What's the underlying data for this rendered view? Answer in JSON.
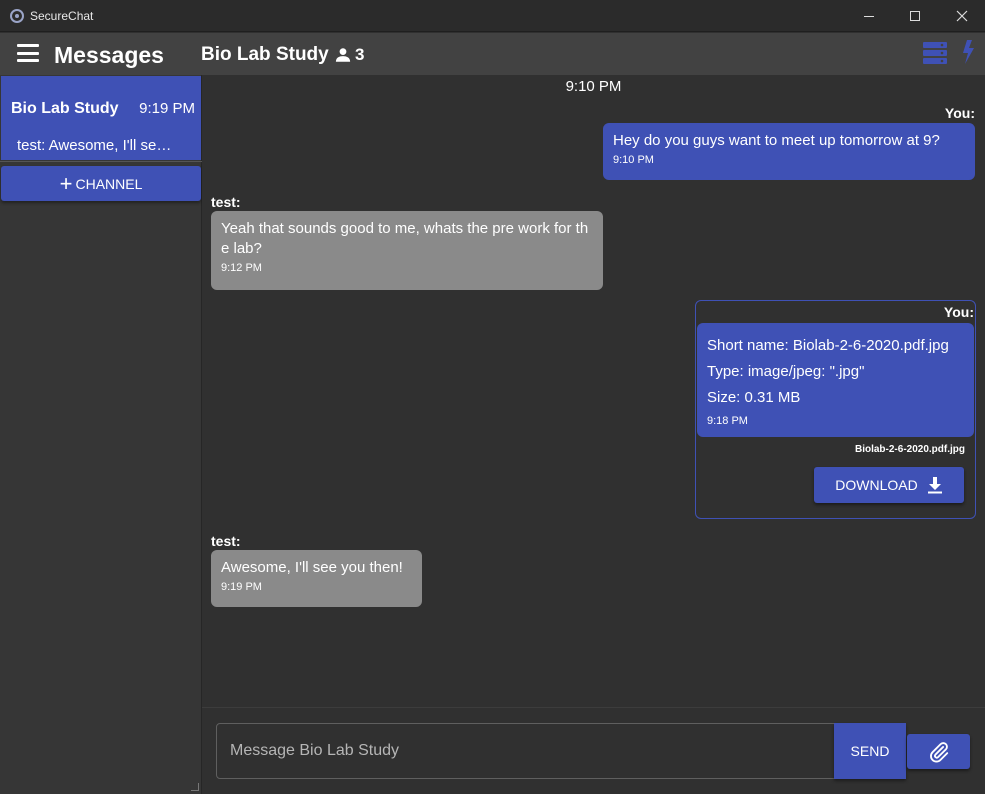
{
  "window": {
    "title": "SecureChat"
  },
  "header": {
    "title": "Messages",
    "channel_name": "Bio Lab Study",
    "member_count": "3"
  },
  "sidebar": {
    "channels": [
      {
        "name": "Bio Lab Study",
        "time": "9:19 PM",
        "preview": "test: Awesome, I'll see you then!"
      }
    ],
    "add_channel_label": "CHANNEL"
  },
  "chat": {
    "date_separator": "9:10 PM",
    "messages": [
      {
        "sender": "You:",
        "text": "Hey do you guys want to meet up tomorrow at 9?",
        "time": "9:10 PM"
      },
      {
        "sender": "test:",
        "text": "Yeah that sounds good to me, whats the pre work for the lab?",
        "time": "9:12 PM"
      },
      {
        "sender": "You:",
        "file": {
          "short_name": "Short name: Biolab-2-6-2020.pdf.jpg",
          "type": "Type: image/jpeg: \".jpg\"",
          "size": "Size: 0.31 MB",
          "filename": "Biolab-2-6-2020.pdf.jpg",
          "download_label": "DOWNLOAD"
        },
        "time": "9:18 PM"
      },
      {
        "sender": "test:",
        "text": "Awesome, I'll see you then!",
        "time": "9:19 PM"
      }
    ]
  },
  "composer": {
    "placeholder": "Message Bio Lab Study",
    "send_label": "SEND"
  },
  "colors": {
    "accent": "#3f51b5",
    "other_bubble": "#8a8a8a",
    "background": "#303030"
  },
  "icons": [
    "app-icon",
    "minimize-icon",
    "maximize-icon",
    "close-icon",
    "menu-icon",
    "person-icon",
    "server-icon",
    "bolt-icon",
    "plus-icon",
    "download-icon",
    "paperclip-icon"
  ]
}
